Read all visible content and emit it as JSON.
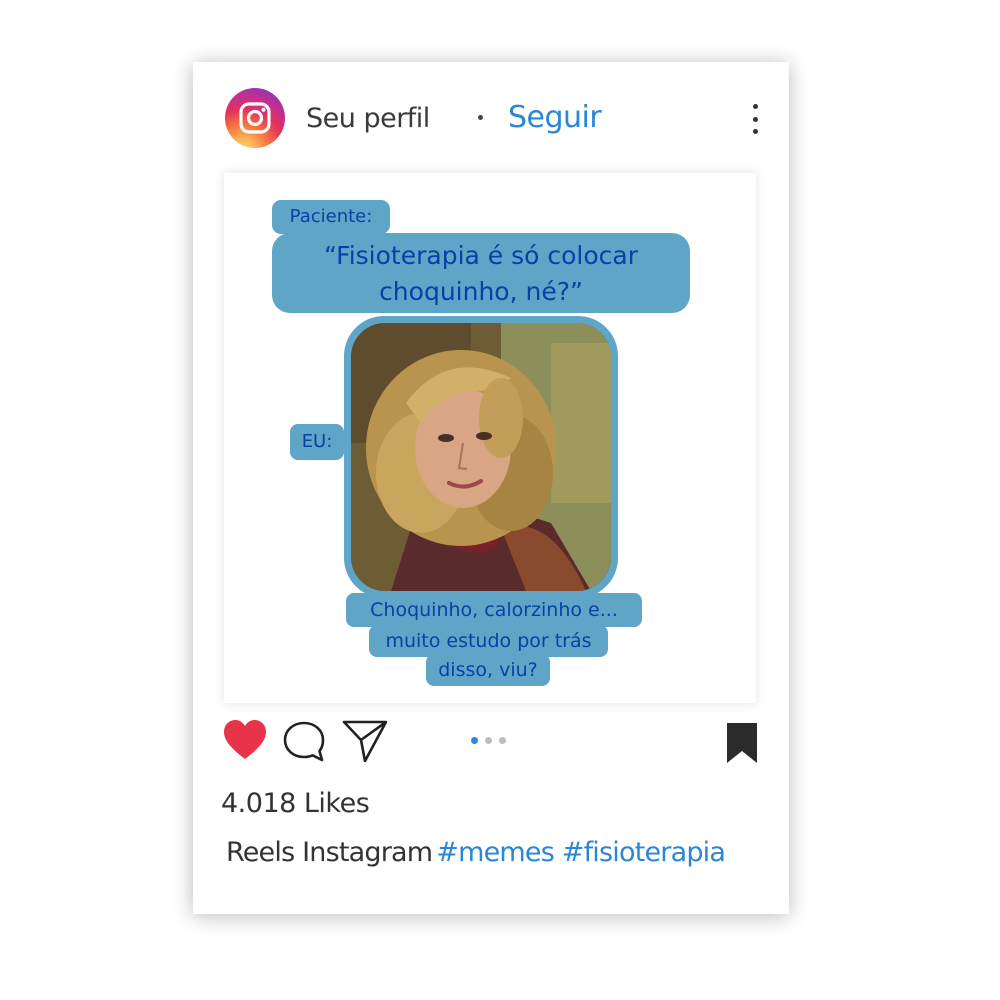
{
  "header": {
    "username": "Seu perfil",
    "follow_label": "Seguir",
    "logo_icon": "instagram-icon",
    "more_icon": "more-vertical-icon"
  },
  "post": {
    "patient_label": "Paciente:",
    "quote_line1": "“Fisioterapia é só colocar",
    "quote_line2": "choquinho, né?”",
    "me_label": "EU:",
    "response_line1": "Choquinho, calorzinho e...",
    "response_line2": "muito estudo por trás",
    "response_line3": "disso, viu?"
  },
  "actions": {
    "like_icon": "heart-icon",
    "comment_icon": "comment-icon",
    "share_icon": "send-icon",
    "save_icon": "bookmark-icon",
    "carousel_count": 3,
    "carousel_active": 1
  },
  "footer": {
    "likes": "4.018 Likes",
    "caption_text": "Reels Instagram",
    "hashtags": "#memes #fisioterapia"
  },
  "colors": {
    "accent": "#2a86d6",
    "like": "#e8334a",
    "bubble": "#5fa5c7",
    "bubble_text": "#0b3fa8"
  }
}
